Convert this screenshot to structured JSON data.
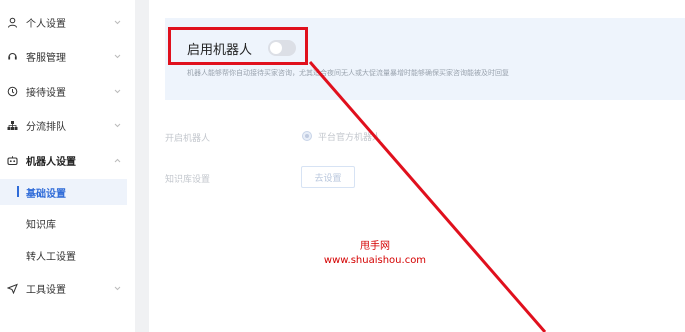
{
  "sidebar": {
    "items": [
      {
        "icon": "user-icon",
        "label": "个人设置"
      },
      {
        "icon": "headset-icon",
        "label": "客服管理"
      },
      {
        "icon": "settings-circle-icon",
        "label": "接待设置"
      },
      {
        "icon": "hierarchy-icon",
        "label": "分流排队"
      },
      {
        "icon": "robot-icon",
        "label": "机器人设置"
      }
    ],
    "sub_items": [
      {
        "label": "基础设置",
        "active": true
      },
      {
        "label": "知识库",
        "active": false
      },
      {
        "label": "转人工设置",
        "active": false
      }
    ],
    "tools": {
      "icon": "send-icon",
      "label": "工具设置"
    }
  },
  "main": {
    "bot_title": "启用机器人",
    "toggle_on": false,
    "description": "机器人能够帮你自动接待买家咨询，尤其适合夜间无人或大促流量暴增时能够确保买家咨询能被及时回复",
    "row1_label": "开启机器人",
    "radio_label": "平台官方机器人",
    "row2_label": "知识库设置",
    "go_button": "去设置"
  },
  "colors": {
    "accent": "#2f6bd8",
    "annotation": "#e0101d",
    "banner": "#eef4fc"
  },
  "watermark": {
    "line1": "甩手网",
    "line2": "www.shuaishou.com"
  }
}
